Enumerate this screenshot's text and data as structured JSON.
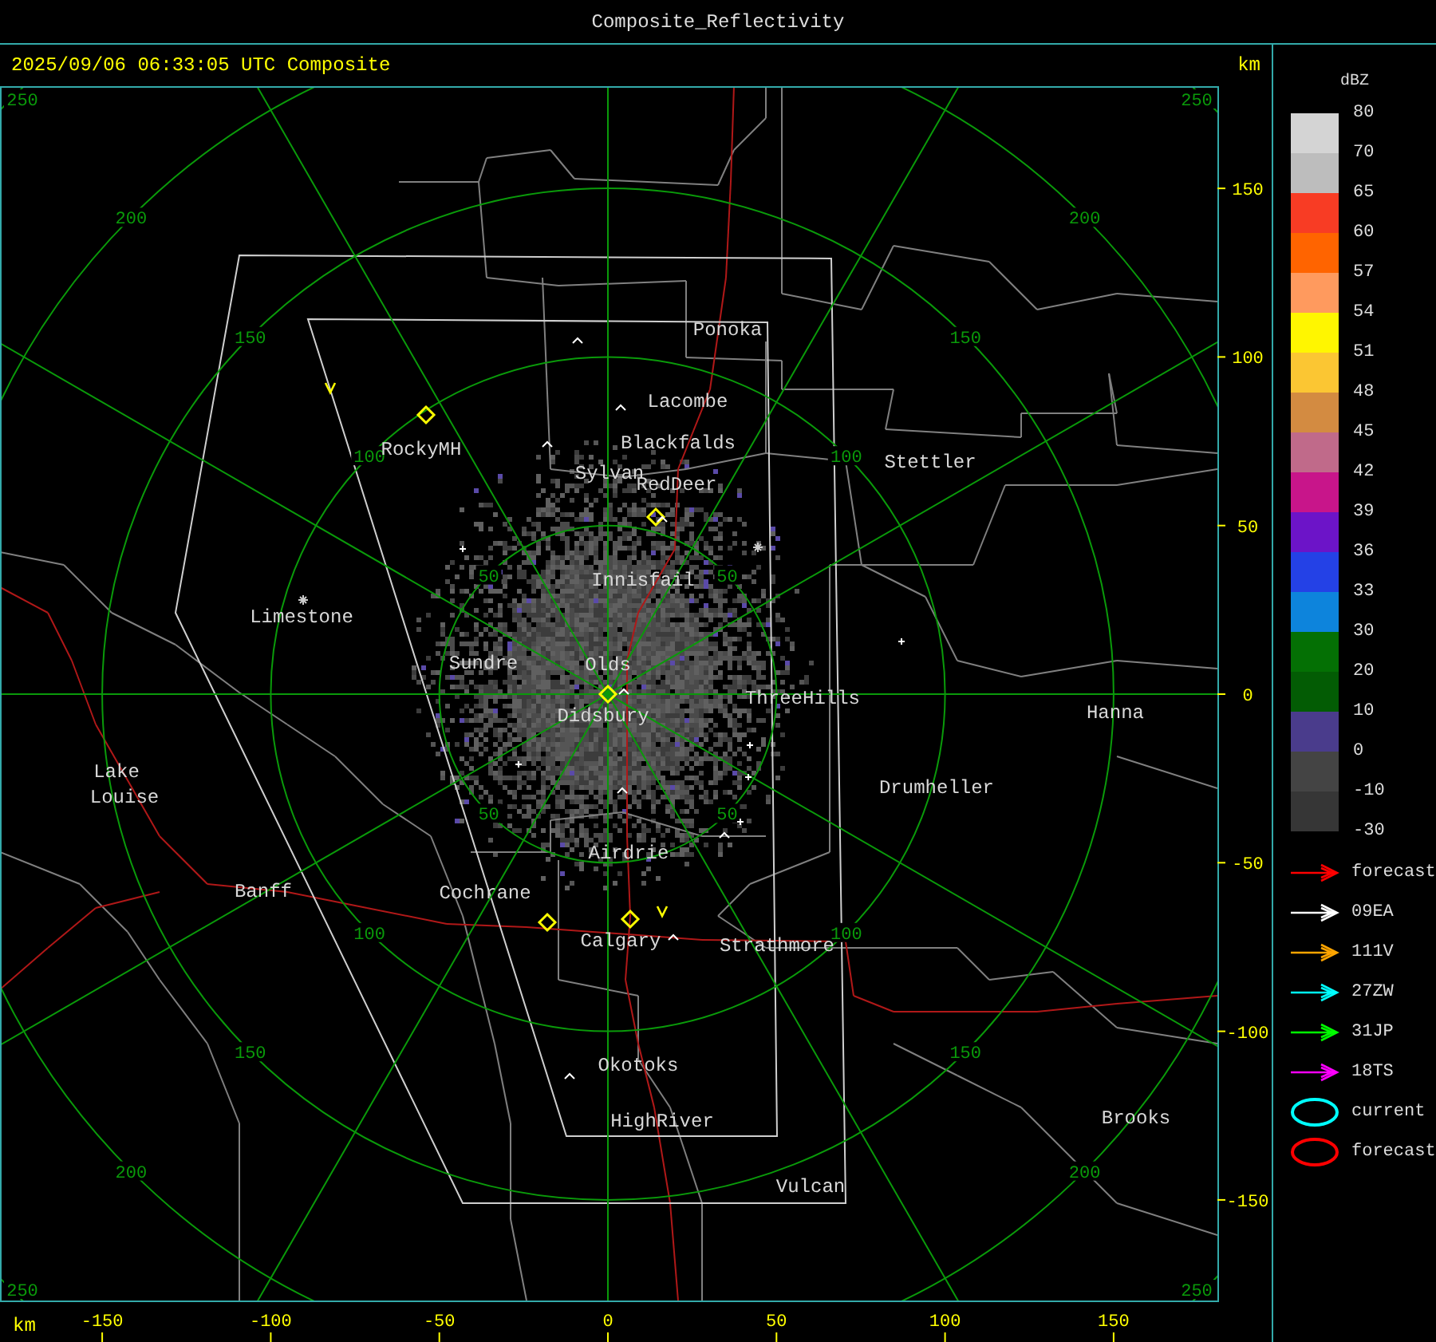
{
  "window": {
    "title": "Composite_Reflectivity"
  },
  "header": {
    "timestamp": "2025/09/06 06:33:05 UTC Composite",
    "unit": "km"
  },
  "map": {
    "range_rings": [
      {
        "labels": [
          "50",
          "50",
          "50",
          "50"
        ]
      },
      {
        "labels": [
          "100",
          "100",
          "100",
          "100"
        ]
      },
      {
        "labels": [
          "150",
          "150",
          "150",
          "150"
        ]
      },
      {
        "labels": [
          "200",
          "200",
          "200",
          "200"
        ]
      },
      {
        "labels": [
          "250",
          "250",
          "250",
          "250"
        ]
      }
    ],
    "places": [
      "Ponoka",
      "Lacombe",
      "Blackfalds",
      "Stettler",
      "Sylvan",
      "RedDeer",
      "RockyMH",
      "Innisfail",
      "Limestone",
      "Sundre",
      "Olds",
      "ThreeHills",
      "Didsbury",
      "Hanna",
      "Lake",
      "Louise",
      "Drumheller",
      "Airdrie",
      "Banff",
      "Cochrane",
      "Calgary",
      "Strathmore",
      "Okotoks",
      "Brooks",
      "HighRiver",
      "Vulcan"
    ]
  },
  "x_axis": {
    "unit": "km",
    "ticks": [
      "-150",
      "-100",
      "-50",
      "0",
      "50",
      "100",
      "150"
    ]
  },
  "y_axis": {
    "ticks": [
      "150",
      "100",
      "50",
      "0",
      "-50",
      "-100",
      "-150"
    ]
  },
  "legend": {
    "unit": "dBZ",
    "bands": [
      {
        "color": "#d4d4d4"
      },
      {
        "color": "#bdbdbd"
      },
      {
        "color": "#f83c24"
      },
      {
        "color": "#ff6400"
      },
      {
        "color": "#ff9a5e"
      },
      {
        "color": "#fff600"
      },
      {
        "color": "#fbc633"
      },
      {
        "color": "#d38b41"
      },
      {
        "color": "#c06a8a"
      },
      {
        "color": "#c8158a"
      },
      {
        "color": "#6c14c8"
      },
      {
        "color": "#2441e6"
      },
      {
        "color": "#0d84dc"
      },
      {
        "color": "#047004"
      },
      {
        "color": "#035c04"
      },
      {
        "color": "#4a3c8c"
      },
      {
        "color": "#444444"
      },
      {
        "color": "#363636"
      }
    ],
    "labels": [
      "80",
      "70",
      "65",
      "60",
      "57",
      "54",
      "51",
      "48",
      "45",
      "42",
      "39",
      "36",
      "33",
      "30",
      "20",
      "10",
      "0",
      "-10",
      "-30"
    ],
    "tracks": [
      {
        "kind": "arrow",
        "color": "#ff0000",
        "label": "forecast"
      },
      {
        "kind": "arrow",
        "color": "#ffffff",
        "label": "09EA"
      },
      {
        "kind": "arrow",
        "color": "#ffa500",
        "label": "111V"
      },
      {
        "kind": "arrow",
        "color": "#00ffff",
        "label": "27ZW"
      },
      {
        "kind": "arrow",
        "color": "#00ff00",
        "label": "31JP"
      },
      {
        "kind": "arrow",
        "color": "#ff00ff",
        "label": "18TS"
      },
      {
        "kind": "ellipse",
        "color": "#00ffff",
        "label": "current"
      },
      {
        "kind": "ellipse",
        "color": "#ff0000",
        "label": "forecast"
      }
    ]
  }
}
